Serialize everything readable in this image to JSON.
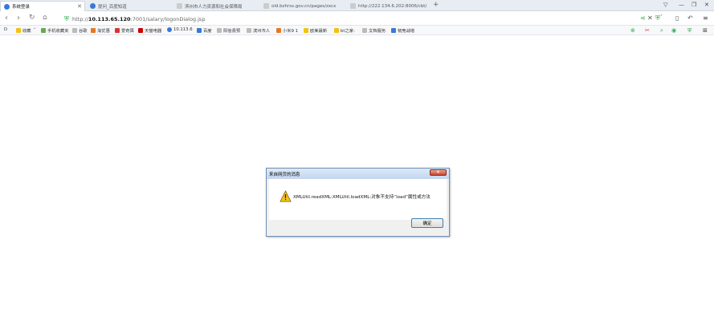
{
  "tabs": [
    {
      "label": "系统登录",
      "color": "#3a78d8"
    },
    {
      "label": "提问_百度知道",
      "color": "#3a78d8"
    },
    {
      "label": "滨州市人力资源和社会保障局",
      "color": "#999999"
    },
    {
      "label": "old.bzhrss.gov.cn/pages/zxcx",
      "color": "#999999"
    },
    {
      "label": "http://222.134.6.202:8006/cbt/",
      "color": "#999999"
    }
  ],
  "new_tab": "+",
  "window_controls": [
    "▽",
    "—",
    "❐",
    "✕"
  ],
  "url": {
    "prefix": "http://",
    "host": "10.113.65.120",
    "rest": ":7001/salary/logonDialog.jsp"
  },
  "bookmarks": [
    {
      "label": "收藏",
      "color": "#f4c20d"
    },
    {
      "label": "手机收藏夹",
      "color": "#6aa84f"
    },
    {
      "label": "谷歌",
      "color": "#bbbbbb"
    },
    {
      "label": "淘优惠",
      "color": "#e87722"
    },
    {
      "label": "爱奇算",
      "color": "#d33"
    },
    {
      "label": "天猫电器",
      "color": "#c00"
    },
    {
      "label": "10.113.6",
      "color": "#3a78d8"
    },
    {
      "label": "百度",
      "color": "#3a78d8"
    },
    {
      "label": "阳信县预",
      "color": "#bbbbbb"
    },
    {
      "label": "滨州市人",
      "color": "#bbbbbb"
    },
    {
      "label": "小米9 1",
      "color": "#e87722"
    },
    {
      "label": "欧美最新",
      "color": "#f4c20d"
    },
    {
      "label": "bt之家-",
      "color": "#f4c20d"
    },
    {
      "label": "文档服务",
      "color": "#bbbbbb"
    },
    {
      "label": "韧竞战塔",
      "color": "#3a78d8"
    }
  ],
  "dialog": {
    "title": "来自网页的消息",
    "close": "✕",
    "message": "XMLUtil.readXML:XMLUtil.loadXML:对象不支持“load”属性或方法",
    "ok": "确定"
  }
}
